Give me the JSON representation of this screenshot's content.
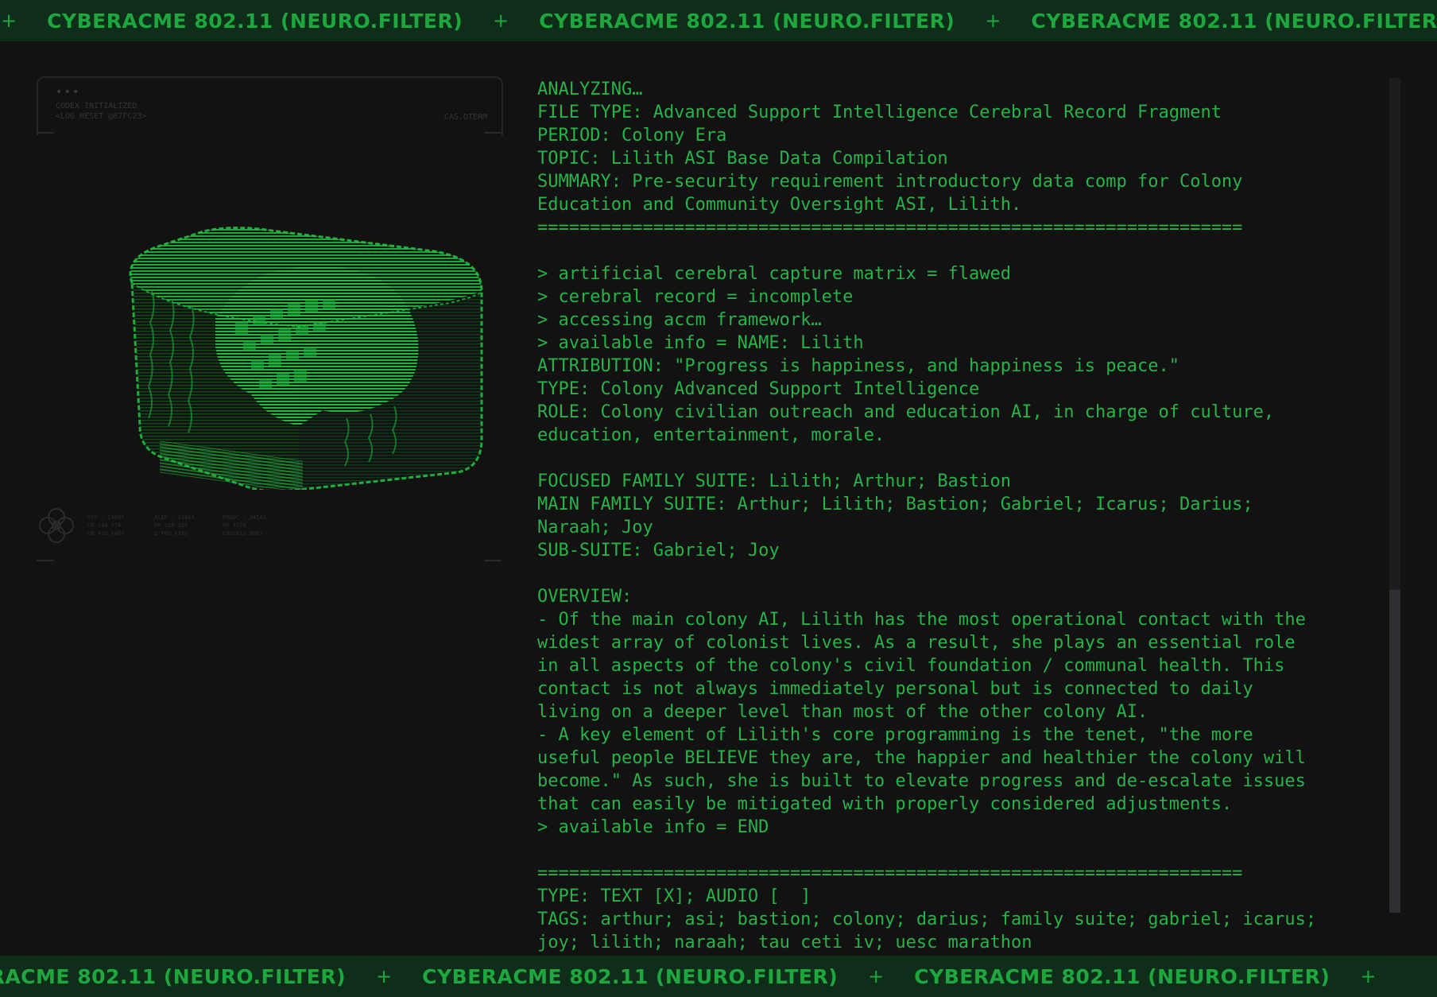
{
  "banner": {
    "text": "CYBERACME 802.11 (NEURO.FILTER)",
    "separator": "+"
  },
  "left_panel": {
    "dots": "•••",
    "line1": "CODEX INITIALIZED",
    "line2": "<LOG RESET @87FC23>",
    "tag": "CAS.QTERM",
    "footer_col1": [
      "SYS : 14897",
      "CR 144 374",
      "CR 432 8487"
    ],
    "footer_col2": [
      "ACEE : 13444",
      "PR 128 334",
      "D-PRO 8320"
    ],
    "footer_col3": [
      "FRAGC : 34543",
      "PR 4778",
      "CODEX12 8887"
    ]
  },
  "terminal": {
    "lines": [
      "ANALYZING…",
      "FILE TYPE: Advanced Support Intelligence Cerebral Record Fragment",
      "PERIOD: Colony Era",
      "TOPIC: Lilith ASI Base Data Compilation",
      "SUMMARY: Pre-security requirement introductory data comp for Colony",
      "Education and Community Oversight ASI, Lilith.",
      "===================================================================",
      "",
      "> artificial cerebral capture matrix = flawed",
      "> cerebral record = incomplete",
      "> accessing accm framework…",
      "> available info = NAME: Lilith",
      "ATTRIBUTION: \"Progress is happiness, and happiness is peace.\"",
      "TYPE: Colony Advanced Support Intelligence",
      "ROLE: Colony civilian outreach and education AI, in charge of culture,",
      "education, entertainment, morale.",
      "",
      "FOCUSED FAMILY SUITE: Lilith; Arthur; Bastion",
      "MAIN FAMILY SUITE: Arthur; Lilith; Bastion; Gabriel; Icarus; Darius;",
      "Naraah; Joy",
      "SUB-SUITE: Gabriel; Joy",
      "",
      "OVERVIEW:",
      "- Of the main colony AI, Lilith has the most operational contact with the",
      "widest array of colonist lives. As a result, she plays an essential role",
      "in all aspects of the colony's civil foundation / communal health. This",
      "contact is not always immediately personal but is connected to daily",
      "living on a deeper level than most of the other colony AI.",
      "- A key element of Lilith's core programming is the tenet, \"the more",
      "useful people BELIEVE they are, the happier and healthier the colony will",
      "become.\" As such, she is built to elevate progress and de-escalate issues",
      "that can easily be mitigated with properly considered adjustments.",
      "> available info = END",
      "",
      "===================================================================",
      "TYPE: TEXT [X]; AUDIO [  ]",
      "TAGS: arthur; asi; bastion; colony; darius; family suite; gabriel; icarus;",
      "joy; lilith; naraah; tau ceti iv; uesc marathon"
    ]
  },
  "colors": {
    "background": "#121212",
    "banner_bg": "#0e2e19",
    "accent_green": "#27b347"
  },
  "icons": [
    "plus-separator-icon",
    "cube-hologram-icon",
    "flower-emblem-icon"
  ]
}
